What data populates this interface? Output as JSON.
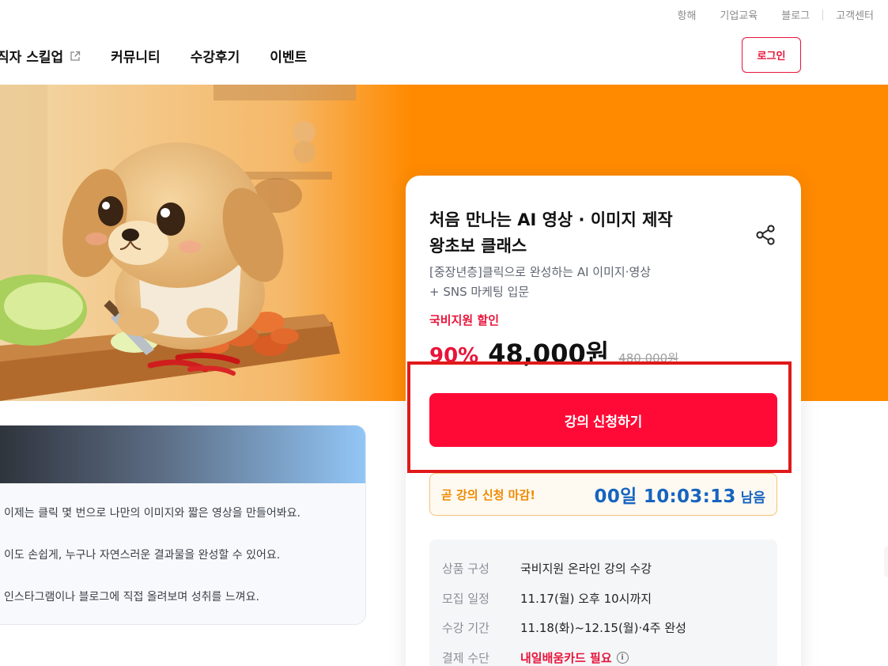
{
  "utility_links": [
    "항해",
    "기업교육",
    "블로그",
    "고객센터"
  ],
  "nav": {
    "items": [
      {
        "label": "직자 스킬업"
      },
      {
        "label": "커뮤니티"
      },
      {
        "label": "수강후기"
      },
      {
        "label": "이벤트"
      }
    ],
    "login_label": "로그인"
  },
  "left_card": {
    "lines": [
      "이제는 클릭 몇 번으로 나만의 이미지와 짧은 영상을 만들어봐요.",
      "이도 손쉽게, 누구나 자연스러운 결과물을 완성할 수 있어요.",
      "인스타그램이나 블로그에 직접 올려보며 성취를 느껴요."
    ]
  },
  "course": {
    "title_line1": "처음 만나는 AI 영상 · 이미지 제작",
    "title_line2": "왕초보 클래스",
    "subtitle_line1": "[중장년층]클릭으로 완성하는 AI 이미지·영상",
    "subtitle_line2": "+ SNS 마케팅 입문",
    "support_label": "국비지원 할인",
    "discount": "90%",
    "price": "48,000원",
    "original_price": "480,000원",
    "cta_label": "강의 신청하기",
    "deadline_label": "곧 강의 신청 마감!",
    "countdown": "00일 10:03:13",
    "remaining_label": "남음",
    "info": [
      {
        "key": "상품 구성",
        "value": "국비지원 온라인 강의 수강"
      },
      {
        "key": "모집 일정",
        "value": "11.17(월) 오후 10시까지"
      },
      {
        "key": "수강 기간",
        "value": "11.18(화)~12.15(월)·4주 완성"
      },
      {
        "key": "결제 수단",
        "value": "내일배움카드 필요"
      }
    ]
  },
  "colors": {
    "accent_red": "#ff0a36",
    "hero_orange": "#ff8a00",
    "timer_blue": "#1664c0",
    "deadline_orange": "#f08a00"
  }
}
